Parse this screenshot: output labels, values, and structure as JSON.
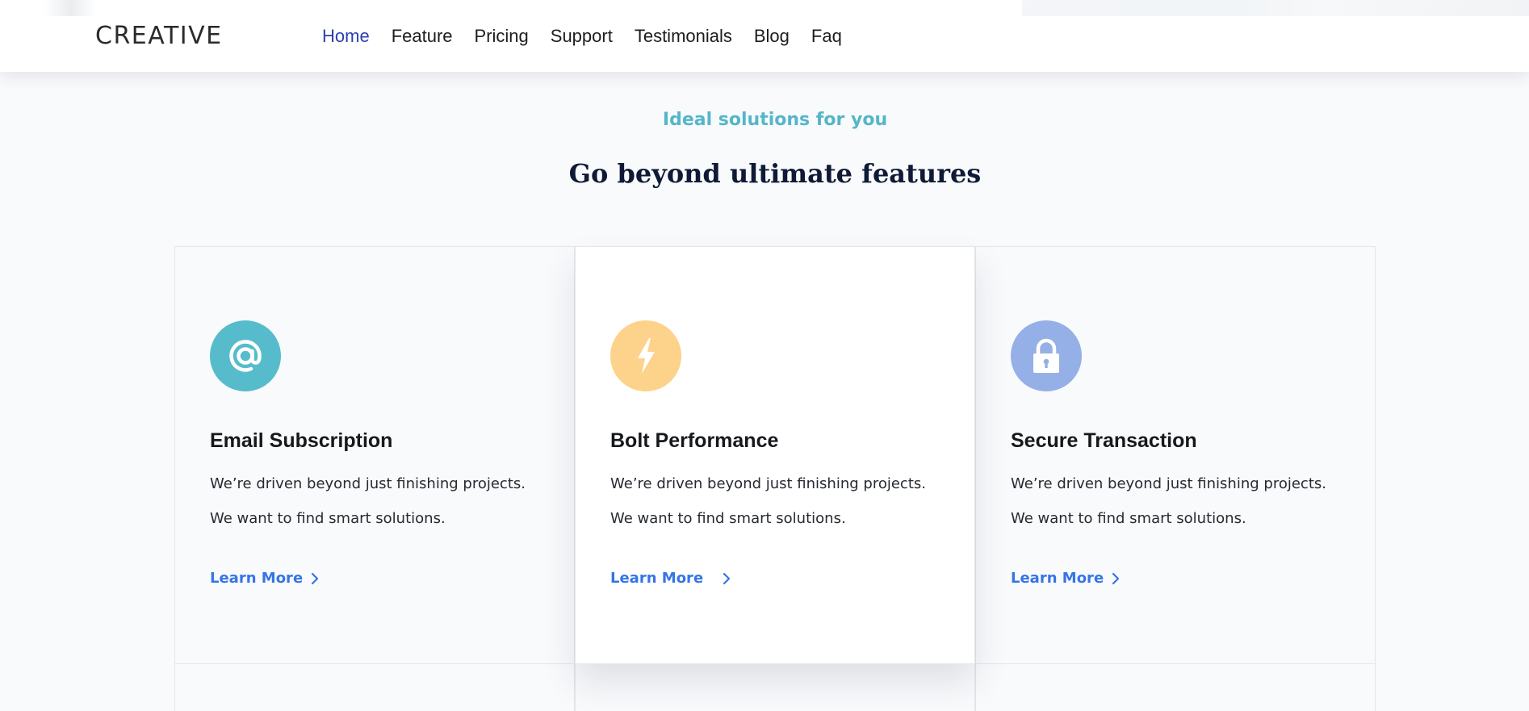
{
  "header": {
    "logo_text": "CREATIVE",
    "nav": [
      {
        "label": "Home",
        "active": true
      },
      {
        "label": "Feature",
        "active": false
      },
      {
        "label": "Pricing",
        "active": false
      },
      {
        "label": "Support",
        "active": false
      },
      {
        "label": "Testimonials",
        "active": false
      },
      {
        "label": "Blog",
        "active": false
      },
      {
        "label": "Faq",
        "active": false
      }
    ]
  },
  "section": {
    "eyebrow": "Ideal solutions for you",
    "headline": "Go beyond ultimate features"
  },
  "cards": [
    {
      "icon": "at-sign-icon",
      "icon_bg": "#56bccb",
      "title": "Email Subscription",
      "description": "We’re driven beyond just finishing projects. We want to find smart solutions.",
      "link_label": "Learn More"
    },
    {
      "icon": "bolt-icon",
      "icon_bg": "#fdd28a",
      "title": "Bolt Performance",
      "description": "We’re driven beyond just finishing projects. We want to find smart solutions.",
      "link_label": "Learn More"
    },
    {
      "icon": "lock-icon",
      "icon_bg": "#95b0e6",
      "title": "Secure Transaction",
      "description": "We’re driven beyond just finishing projects. We want to find smart solutions.",
      "link_label": "Learn More"
    }
  ],
  "colors": {
    "accent_link": "#3575e6",
    "nav_active": "#2a3fb0",
    "eyebrow": "#55b6c9",
    "headline": "#0f1a36",
    "page_bg": "#f9fafc"
  }
}
